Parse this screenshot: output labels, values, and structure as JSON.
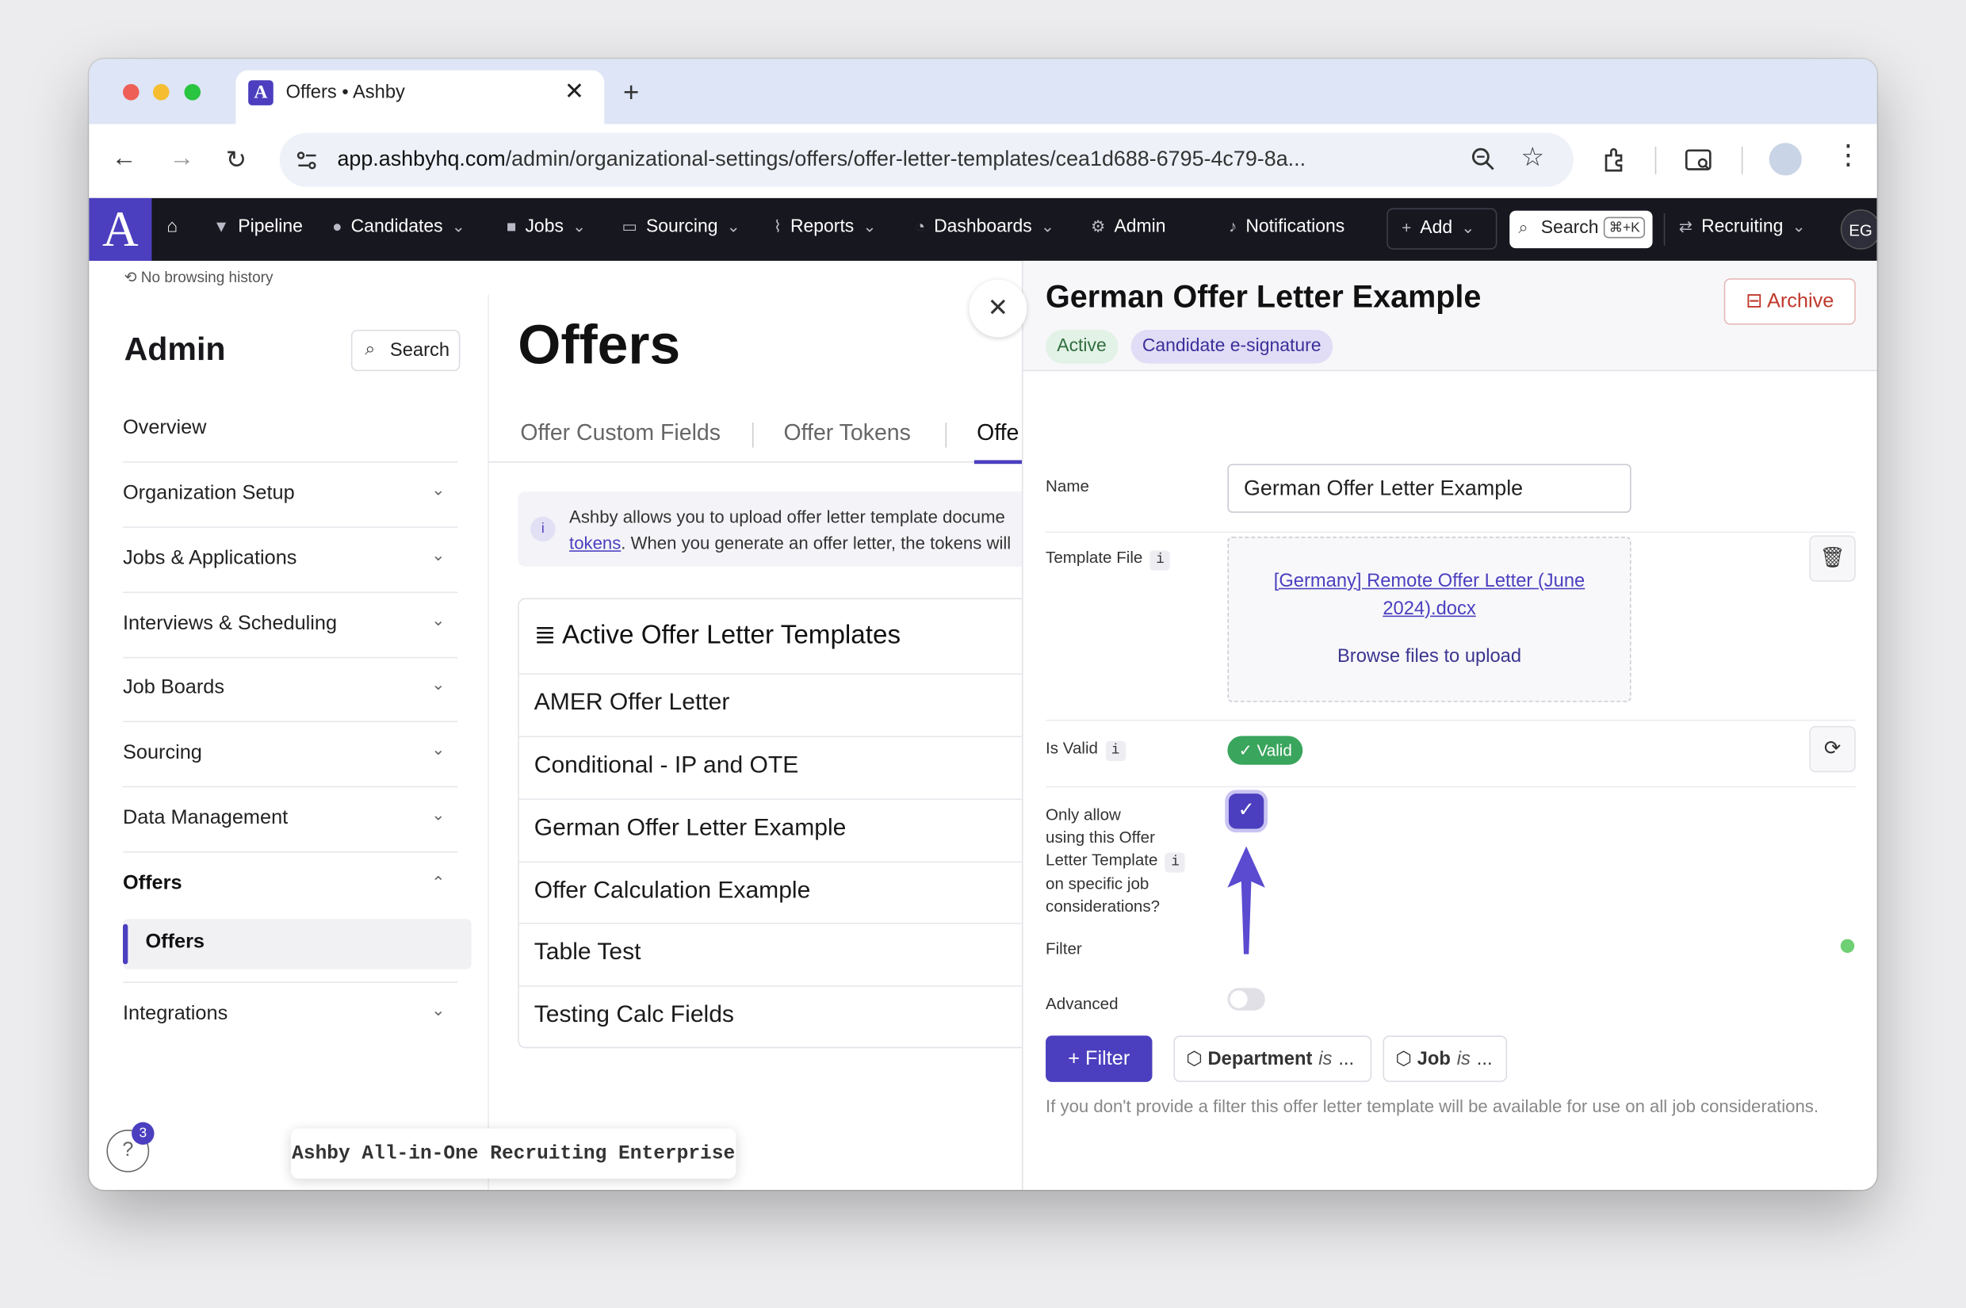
{
  "browser": {
    "tab_title": "Offers • Ashby",
    "url_domain": "app.ashbyhq.com",
    "url_path": "/admin/organizational-settings/offers/offer-letter-templates/cea1d688-6795-4c79-8a..."
  },
  "topnav": {
    "logo": "A",
    "items": [
      "Pipeline",
      "Candidates",
      "Jobs",
      "Sourcing",
      "Reports",
      "Dashboards",
      "Admin"
    ],
    "notifications": "Notifications",
    "add": "Add",
    "search": "Search",
    "search_shortcut": "⌘+K",
    "recruiting": "Recruiting",
    "avatar": "EG"
  },
  "history": "No browsing history",
  "sidebar": {
    "title": "Admin",
    "search": "Search",
    "items": [
      "Overview",
      "Organization Setup",
      "Jobs & Applications",
      "Interviews & Scheduling",
      "Job Boards",
      "Sourcing",
      "Data Management",
      "Offers",
      "Integrations"
    ],
    "sub_selected": "Offers",
    "help_badge": "3"
  },
  "main": {
    "title": "Offers",
    "tabs": [
      "Offer Custom Fields",
      "Offer Tokens",
      "Offe"
    ],
    "info_line1": "Ashby allows you to upload offer letter template docume",
    "info_link": "tokens",
    "info_line2": ". When you generate an offer letter, the tokens will",
    "card_title": "Active Offer Letter Templates",
    "templates": [
      "AMER Offer Letter",
      "Conditional - IP and OTE",
      "German Offer Letter Example",
      "Offer Calculation Example",
      "Table Test",
      "Testing Calc Fields"
    ]
  },
  "footer_label": "Ashby All-in-One Recruiting Enterprise",
  "panel": {
    "title": "German Offer Letter Example",
    "chip_active": "Active",
    "chip_esign": "Candidate e-signature",
    "archive": "Archive",
    "name_label": "Name",
    "name_value": "German Offer Letter Example",
    "template_label": "Template File",
    "file_link": "[Germany] Remote Offer Letter (June 2024).docx",
    "browse": "Browse files to upload",
    "valid_label": "Is Valid",
    "valid_value": "Valid",
    "only_allow_label": [
      "Only allow",
      "using this Offer",
      "Letter Template",
      "on specific job",
      "considerations?"
    ],
    "only_allow_checked": true,
    "filter_label": "Filter",
    "advanced_label": "Advanced",
    "advanced_on": false,
    "filter_button": "Filter",
    "filter_tags": [
      {
        "field": "Department",
        "op": "is",
        "value": "..."
      },
      {
        "field": "Job",
        "op": "is",
        "value": "..."
      }
    ],
    "hint": "If you don't provide a filter this offer letter template will be available for use on all job considerations."
  },
  "colors": {
    "brand": "#4b3fbf",
    "nav_bg": "#17171f",
    "valid": "#3aa55d",
    "archive": "#c0392b"
  }
}
